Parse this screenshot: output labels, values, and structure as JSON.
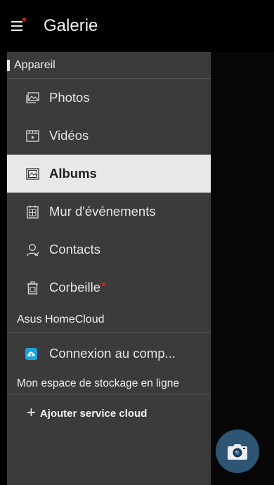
{
  "app": {
    "title": "Galerie"
  },
  "drawer": {
    "device_section": "Appareil",
    "items": [
      {
        "label": "Photos",
        "icon": "photo-icon"
      },
      {
        "label": "Vidéos",
        "icon": "video-icon"
      },
      {
        "label": "Albums",
        "icon": "album-icon",
        "selected": true
      },
      {
        "label": "Mur d'événements",
        "icon": "event-wall-icon"
      },
      {
        "label": "Contacts",
        "icon": "contacts-icon"
      },
      {
        "label": "Corbeille",
        "icon": "trash-icon",
        "badge": "red-dot"
      }
    ],
    "homecloud_section": "Asus HomeCloud",
    "cloud_account_label": "Connexion au comp...",
    "storage_section": "Mon espace de stockage en ligne",
    "add_cloud_label": "Ajouter service cloud"
  },
  "colors": {
    "drawer_bg": "#3b3b3b",
    "selected_bg": "#e8e8e8",
    "notification": "#e01b1b",
    "cloud_blue": "#1da3dc",
    "fab_bg": "#2f5574"
  }
}
